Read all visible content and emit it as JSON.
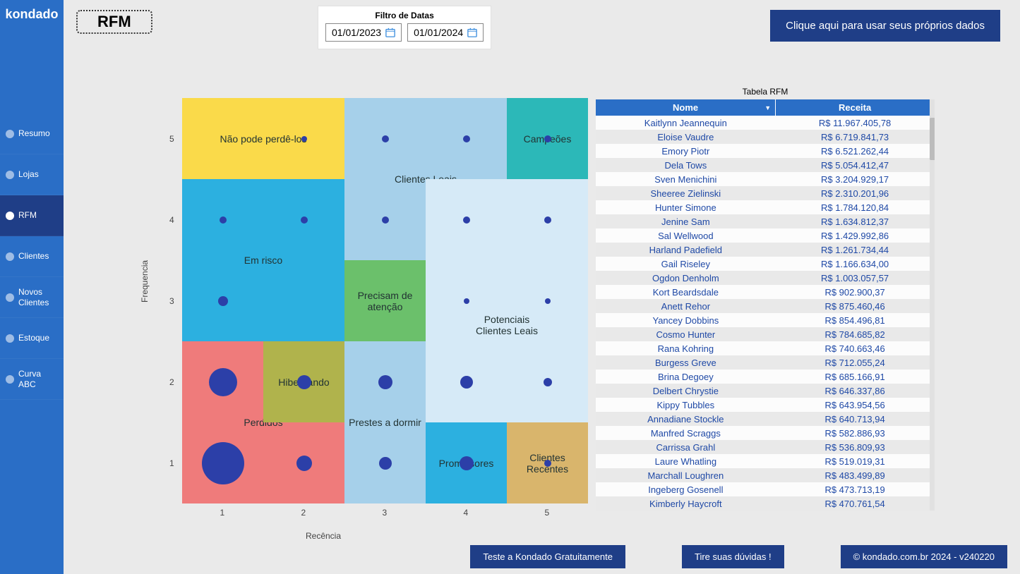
{
  "brand": "kondado",
  "page_title": "RFM",
  "sidebar": {
    "items": [
      {
        "label": "Resumo"
      },
      {
        "label": "Lojas"
      },
      {
        "label": "RFM",
        "active": true
      },
      {
        "label": "Clientes"
      },
      {
        "label": "Novos Clientes"
      },
      {
        "label": "Estoque"
      },
      {
        "label": "Curva ABC"
      }
    ]
  },
  "filter": {
    "title": "Filtro de Datas",
    "from": "01/01/2023",
    "to": "01/01/2024"
  },
  "cta": "Clique aqui para usar seus próprios dados",
  "chart_data": {
    "type": "scatter",
    "xlabel": "Recência",
    "ylabel": "Frequencia",
    "xlim": [
      0.5,
      5.5
    ],
    "ylim": [
      0.5,
      5.5
    ],
    "xticks": [
      1,
      2,
      3,
      4,
      5
    ],
    "yticks": [
      1,
      2,
      3,
      4,
      5
    ],
    "regions": [
      {
        "name": "Não pode perdê-los",
        "x1": 1,
        "x2": 2,
        "y1": 5,
        "y2": 5,
        "fill": "#fada4a"
      },
      {
        "name": "Clientes Leais",
        "x1": 3,
        "x2": 4,
        "y1": 3,
        "y2": 5,
        "fill": "#a6d0ea",
        "textY": 4.5
      },
      {
        "name": "Campeões",
        "x1": 5,
        "x2": 5,
        "y1": 5,
        "y2": 5,
        "fill": "#2cb8b8"
      },
      {
        "name": "Em risco",
        "x1": 1,
        "x2": 2,
        "y1": 3,
        "y2": 4,
        "fill": "#2cb0e0"
      },
      {
        "name": "Precisam de atenção",
        "x1": 3,
        "x2": 3,
        "y1": 3,
        "y2": 3,
        "fill": "#6bc06b"
      },
      {
        "name": "Potenciais Clientes Leais",
        "x1": 4,
        "x2": 5,
        "y1": 2,
        "y2": 4,
        "fill": "#d6eaf7",
        "textY": 2.7
      },
      {
        "name": "Perdidos",
        "x1": 1,
        "x2": 2,
        "y1": 1,
        "y2": 2,
        "fill": "#ef7b7b",
        "textX": 1.5,
        "textY": 1.5
      },
      {
        "name": "Hibernando",
        "x1": 2,
        "x2": 2,
        "y1": 2,
        "y2": 2,
        "fill": "#b0b34c",
        "override_x1": 2
      },
      {
        "name": "Prestes a dormir",
        "x1": 3,
        "x2": 3,
        "y1": 1,
        "y2": 2,
        "fill": "#a6d0ea"
      },
      {
        "name": "Promissores",
        "x1": 4,
        "x2": 4,
        "y1": 1,
        "y2": 1,
        "fill": "#2cb0e0"
      },
      {
        "name": "Clientes Recentes",
        "x1": 5,
        "x2": 5,
        "y1": 1,
        "y2": 1,
        "fill": "#d9b56c"
      }
    ],
    "points": [
      {
        "x": 1,
        "y": 1,
        "size": 60
      },
      {
        "x": 2,
        "y": 1,
        "size": 22
      },
      {
        "x": 3,
        "y": 1,
        "size": 18
      },
      {
        "x": 4,
        "y": 1,
        "size": 20
      },
      {
        "x": 5,
        "y": 1,
        "size": 10
      },
      {
        "x": 1,
        "y": 2,
        "size": 40
      },
      {
        "x": 2,
        "y": 2,
        "size": 20
      },
      {
        "x": 3,
        "y": 2,
        "size": 20
      },
      {
        "x": 4,
        "y": 2,
        "size": 18
      },
      {
        "x": 5,
        "y": 2,
        "size": 12
      },
      {
        "x": 1,
        "y": 3,
        "size": 14
      },
      {
        "x": 4,
        "y": 3,
        "size": 8
      },
      {
        "x": 5,
        "y": 3,
        "size": 8
      },
      {
        "x": 1,
        "y": 4,
        "size": 10
      },
      {
        "x": 2,
        "y": 4,
        "size": 10
      },
      {
        "x": 3,
        "y": 4,
        "size": 10
      },
      {
        "x": 4,
        "y": 4,
        "size": 10
      },
      {
        "x": 5,
        "y": 4,
        "size": 10
      },
      {
        "x": 2,
        "y": 5,
        "size": 8
      },
      {
        "x": 3,
        "y": 5,
        "size": 10
      },
      {
        "x": 4,
        "y": 5,
        "size": 10
      },
      {
        "x": 5,
        "y": 5,
        "size": 10
      }
    ]
  },
  "table": {
    "title": "Tabela RFM",
    "columns": [
      "Nome",
      "Receita"
    ],
    "sort_col": 0,
    "rows": [
      [
        "Kaitlynn Jeannequin",
        "R$ 11.967.405,78"
      ],
      [
        "Eloise Vaudre",
        "R$ 6.719.841,73"
      ],
      [
        "Emory Piotr",
        "R$ 6.521.262,44"
      ],
      [
        "Dela Tows",
        "R$ 5.054.412,47"
      ],
      [
        "Sven Menichini",
        "R$ 3.204.929,17"
      ],
      [
        "Sheeree Zielinski",
        "R$ 2.310.201,96"
      ],
      [
        "Hunter Simone",
        "R$ 1.784.120,84"
      ],
      [
        "Jenine Sam",
        "R$ 1.634.812,37"
      ],
      [
        "Sal Wellwood",
        "R$ 1.429.992,86"
      ],
      [
        "Harland Padefield",
        "R$ 1.261.734,44"
      ],
      [
        "Gail Riseley",
        "R$ 1.166.634,00"
      ],
      [
        "Ogdon Denholm",
        "R$ 1.003.057,57"
      ],
      [
        "Kort Beardsdale",
        "R$ 902.900,37"
      ],
      [
        "Anett Rehor",
        "R$ 875.460,46"
      ],
      [
        "Yancey Dobbins",
        "R$ 854.496,81"
      ],
      [
        "Cosmo Hunter",
        "R$ 784.685,82"
      ],
      [
        "Rana Kohring",
        "R$ 740.663,46"
      ],
      [
        "Burgess Greve",
        "R$ 712.055,24"
      ],
      [
        "Brina Degoey",
        "R$ 685.166,91"
      ],
      [
        "Delbert Chrystie",
        "R$ 646.337,86"
      ],
      [
        "Kippy Tubbles",
        "R$ 643.954,56"
      ],
      [
        "Annadiane Stockle",
        "R$ 640.713,94"
      ],
      [
        "Manfred Scraggs",
        "R$ 582.886,93"
      ],
      [
        "Carrissa Grahl",
        "R$ 536.809,93"
      ],
      [
        "Laure Whatling",
        "R$ 519.019,31"
      ],
      [
        "Marchall Loughren",
        "R$ 483.499,89"
      ],
      [
        "Ingeberg Gosenell",
        "R$ 473.713,19"
      ],
      [
        "Kimberly Haycroft",
        "R$ 470.761,54"
      ]
    ]
  },
  "footer": {
    "btn1": "Teste a Kondado Gratuitamente",
    "btn2": "Tire suas dúvidas !",
    "btn3": "© kondado.com.br 2024 - v240220"
  }
}
